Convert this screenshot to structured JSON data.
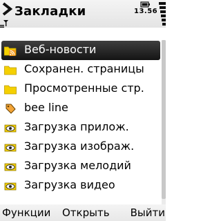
{
  "header": {
    "title": "Закладки",
    "time": "13.56",
    "icons": {
      "back": "back-arrow-icon",
      "antenna": "antenna-icon",
      "signal": "signal-bars-icon",
      "battery": "battery-icon",
      "battery_level": "battery-bars-icon"
    }
  },
  "bookmarks": {
    "selected_index": 0,
    "items": [
      {
        "label": "Веб-новости",
        "icon": "rss-folder-icon"
      },
      {
        "label": "Сохранен. страницы",
        "icon": "folder-icon"
      },
      {
        "label": "Просмотренные стр.",
        "icon": "folder-icon"
      },
      {
        "label": "bee line",
        "icon": "bookmark-tag-icon"
      },
      {
        "label": "Загрузка прилож.",
        "icon": "bookmark-eye-icon"
      },
      {
        "label": "Загрузка изображ.",
        "icon": "bookmark-eye-icon"
      },
      {
        "label": "Загрузка мелодий",
        "icon": "bookmark-eye-icon"
      },
      {
        "label": "Загрузка видео",
        "icon": "bookmark-eye-icon"
      }
    ]
  },
  "softkeys": {
    "left": "Функции",
    "center": "Открыть",
    "right": "Выйти"
  },
  "colors": {
    "selection": "#1e1e1e",
    "folder": "#f5d000",
    "rss": "#f39a1a"
  }
}
